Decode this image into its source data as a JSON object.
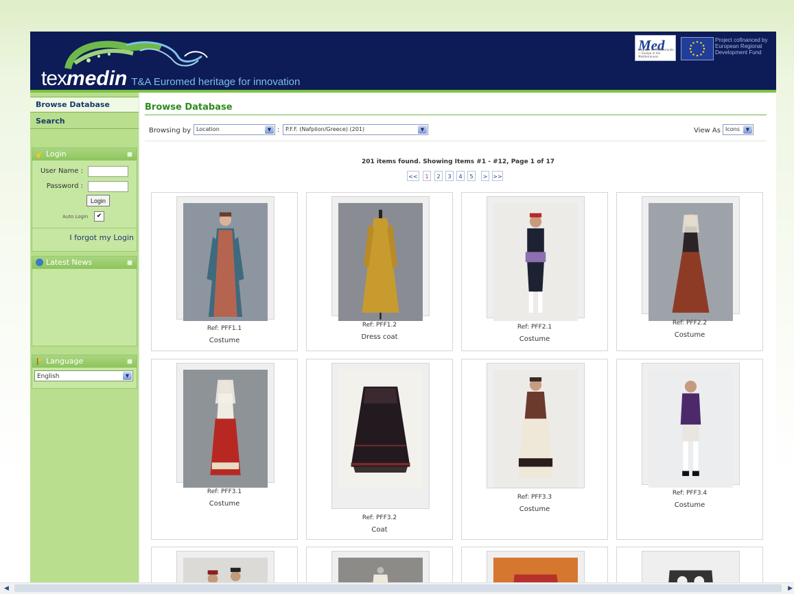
{
  "header": {
    "logo_part1": "tex",
    "logo_part2": "med",
    "logo_part3": "in",
    "tagline": "T&A Euromed heritage for innovation",
    "med_logo": "Med",
    "med_sub": "L'Europe de Méditerranée — Europe in the Mediterranean",
    "eu_text": "Project cofinanced by European Regional Development Fund"
  },
  "sidebar": {
    "nav": [
      {
        "label": "Browse Database"
      },
      {
        "label": "Search"
      }
    ],
    "login": {
      "title": "Login",
      "username_label": "User Name :",
      "username_value": "",
      "password_label": "Password :",
      "password_value": "",
      "button": "Login",
      "auto_login_label": "Auto Login",
      "auto_login_checked": "✔",
      "forgot": "I forgot my Login"
    },
    "news": {
      "title": "Latest News"
    },
    "language": {
      "title": "Language",
      "selected": "English"
    }
  },
  "main": {
    "title": "Browse Database",
    "browsing_by_label": "Browsing by",
    "browse_field": "Location",
    "separator": ":",
    "browse_value": "P.F.F. (Nafplion/Greece) (201)",
    "view_as_label": "View As",
    "view_as_value": "Icons",
    "results_text": "201 items found. Showing Items #1 - #12,   Page 1 of 17",
    "pager": [
      "<<",
      "1",
      "2",
      "3",
      "4",
      "5",
      ">",
      ">>"
    ],
    "current_page": "1",
    "items": [
      {
        "ref": "Ref: PFF1.1",
        "name": "Costume"
      },
      {
        "ref": "Ref: PFF1.2",
        "name": "Dress coat"
      },
      {
        "ref": "Ref: PFF2.1",
        "name": "Costume"
      },
      {
        "ref": "Ref: PFF2.2",
        "name": "Costume"
      },
      {
        "ref": "Ref: PFF3.1",
        "name": "Costume"
      },
      {
        "ref": "Ref: PFF3.2",
        "name": "Coat"
      },
      {
        "ref": "Ref: PFF3.3",
        "name": "Costume"
      },
      {
        "ref": "Ref: PFF3.4",
        "name": "Costume"
      }
    ]
  },
  "colors": {
    "header_bg": "#0d1b56",
    "accent_green": "#79c43f",
    "sidebar_bg": "#b9de8e",
    "title_green": "#2e8a1e"
  }
}
